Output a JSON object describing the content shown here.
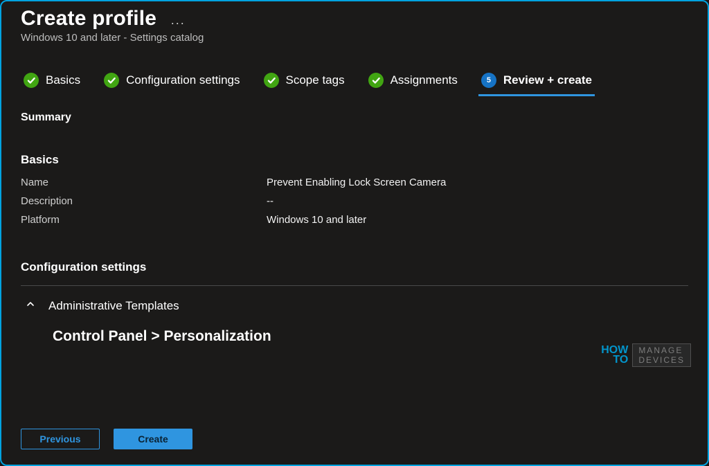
{
  "header": {
    "title": "Create profile",
    "subtitle": "Windows 10 and later - Settings catalog"
  },
  "wizard": {
    "steps": [
      {
        "label": "Basics",
        "state": "done"
      },
      {
        "label": "Configuration settings",
        "state": "done"
      },
      {
        "label": "Scope tags",
        "state": "done"
      },
      {
        "label": "Assignments",
        "state": "done"
      },
      {
        "label": "Review + create",
        "state": "current",
        "number": "5"
      }
    ]
  },
  "summary": {
    "heading": "Summary",
    "basics_heading": "Basics",
    "rows": [
      {
        "key": "Name",
        "value": "Prevent Enabling Lock Screen Camera"
      },
      {
        "key": "Description",
        "value": "--"
      },
      {
        "key": "Platform",
        "value": "Windows 10 and later"
      }
    ],
    "config_heading": "Configuration settings",
    "accordion_label": "Administrative Templates",
    "category_path": "Control Panel > Personalization"
  },
  "footer": {
    "previous": "Previous",
    "create": "Create"
  },
  "watermark": {
    "how": "HOW",
    "to": "TO",
    "l1": "MANAGE",
    "l2": "DEVICES"
  }
}
